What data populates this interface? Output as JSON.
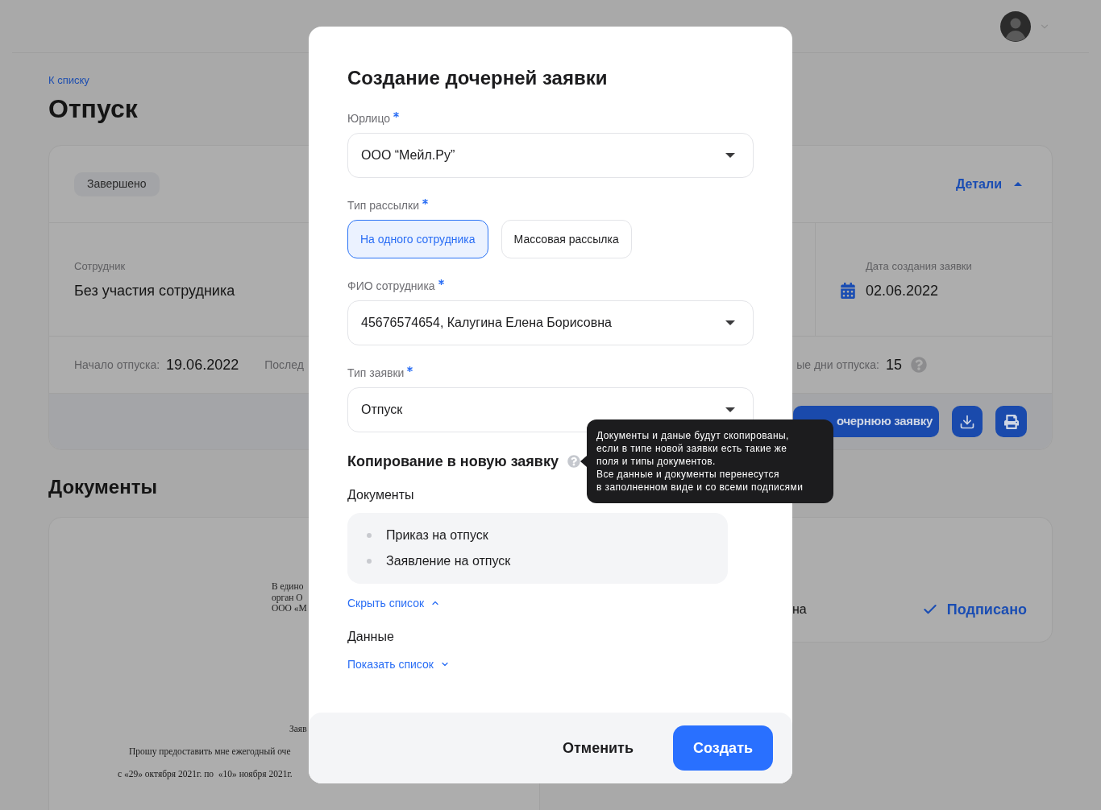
{
  "page": {
    "back_link": "К списку",
    "title": "Отпуск"
  },
  "request_card": {
    "status": "Завершено",
    "details": {
      "label": "Детали",
      "expanded": true
    },
    "employee": {
      "label": "Сотрудник",
      "value": "Без участия сотрудника"
    },
    "created": {
      "label": "Дата создания заявки",
      "value": "02.06.2022"
    },
    "period": [
      {
        "label": "Начало отпуска:",
        "value": "19.06.2022"
      },
      {
        "label": "Послед"
      }
    ],
    "days": {
      "label": "ые дни отпуска:",
      "value": "15"
    },
    "create_child_button": "очернюю заявку"
  },
  "documents": {
    "title": "Документы",
    "preview": {
      "address_lines": [
        "В едино",
        "орган О",
        "ООО «М"
      ],
      "heading": "Заяв",
      "body_lines": [
        "Прошу предоставить мне ежегодный оче",
        "с «29» октября 2021г. по  «10» ноября 2021г."
      ]
    },
    "file": {
      "name": "на",
      "status": "Подписано"
    }
  },
  "modal": {
    "title": "Создание дочерней заявки",
    "fields": [
      {
        "kind": "select",
        "label": "Юрлицо",
        "required": true,
        "value": "ООО “Мейл.Ру”"
      },
      {
        "kind": "toggle",
        "label": "Тип рассылки",
        "required": true,
        "options": [
          {
            "label": "На одного сотрудника",
            "selected": true
          },
          {
            "label": "Массовая рассылка",
            "selected": false
          }
        ]
      },
      {
        "kind": "select",
        "label": "ФИО сотрудника",
        "required": true,
        "value": "45676574654, Калугина Елена Борисовна"
      },
      {
        "kind": "select",
        "label": "Тип заявки",
        "required": true,
        "value": "Отпуск"
      }
    ],
    "copy_section": {
      "title": "Копирование в новую заявку",
      "tooltip": [
        "Документы и даные будут скопированы,",
        "если в типе новой заявки есть такие же",
        "поля и типы документов.",
        "Все данные и документы перенесутся",
        "в заполненном виде и со всеми подписями"
      ],
      "groups": [
        {
          "title": "Документы",
          "expanded": true,
          "items": [
            "Приказ на отпуск",
            "Заявление на отпуск"
          ],
          "toggle": "Скрыть список"
        },
        {
          "title": "Данные",
          "expanded": false,
          "toggle": "Показать список"
        }
      ]
    },
    "buttons": [
      {
        "kind": "secondary",
        "label": "Отменить"
      },
      {
        "kind": "primary",
        "label": "Создать"
      }
    ]
  }
}
